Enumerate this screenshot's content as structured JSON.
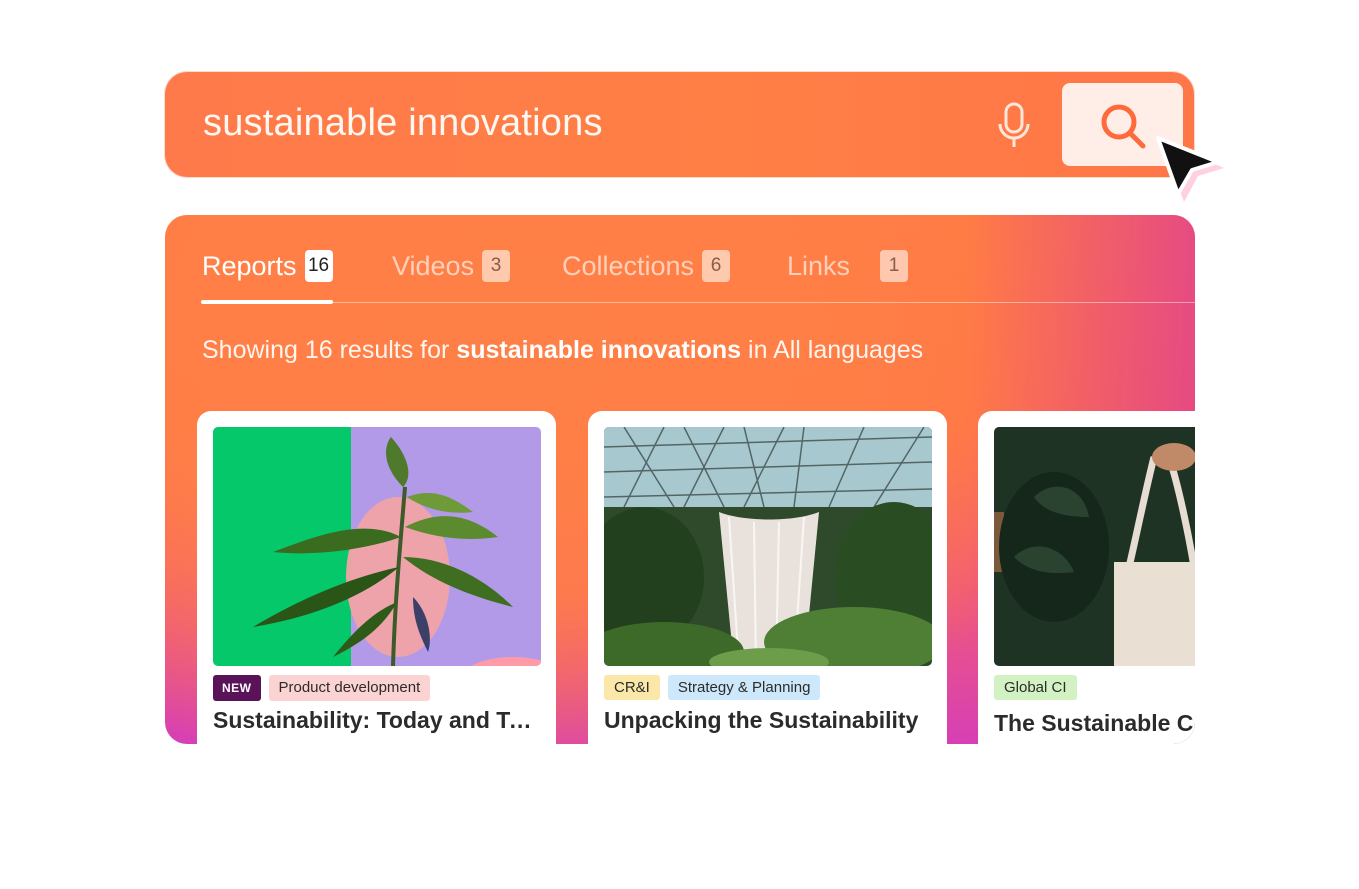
{
  "search": {
    "query": "sustainable innovations",
    "mic_icon": "microphone-icon",
    "search_icon": "search-icon"
  },
  "tabs": [
    {
      "label": "Reports",
      "count": "16",
      "active": true
    },
    {
      "label": "Videos",
      "count": "3",
      "active": false
    },
    {
      "label": "Collections",
      "count": "6",
      "active": false
    },
    {
      "label": "Links",
      "count": "1",
      "active": false
    }
  ],
  "summary": {
    "prefix": "Showing 16 results for",
    "query": "sustainable innovations",
    "suffix": "in All languages"
  },
  "cards": [
    {
      "tags": [
        {
          "label": "NEW",
          "color": "#5a1259"
        },
        {
          "label": "Product development",
          "color": "#fcd3d3"
        }
      ],
      "title": "Sustainability: Today and Tomorrow"
    },
    {
      "tags": [
        {
          "label": "CR&I",
          "color": "#fbe7a8"
        },
        {
          "label": "Strategy & Planning",
          "color": "#cde8fb"
        }
      ],
      "title": "Unpacking the Sustainability"
    },
    {
      "tags": [
        {
          "label": "Global CI",
          "color": "#d3f2c4"
        }
      ],
      "title": "The Sustainable C"
    }
  ],
  "colors": {
    "accent": "#ff7a4a",
    "panel_gradient_end": "#d73fb5"
  }
}
